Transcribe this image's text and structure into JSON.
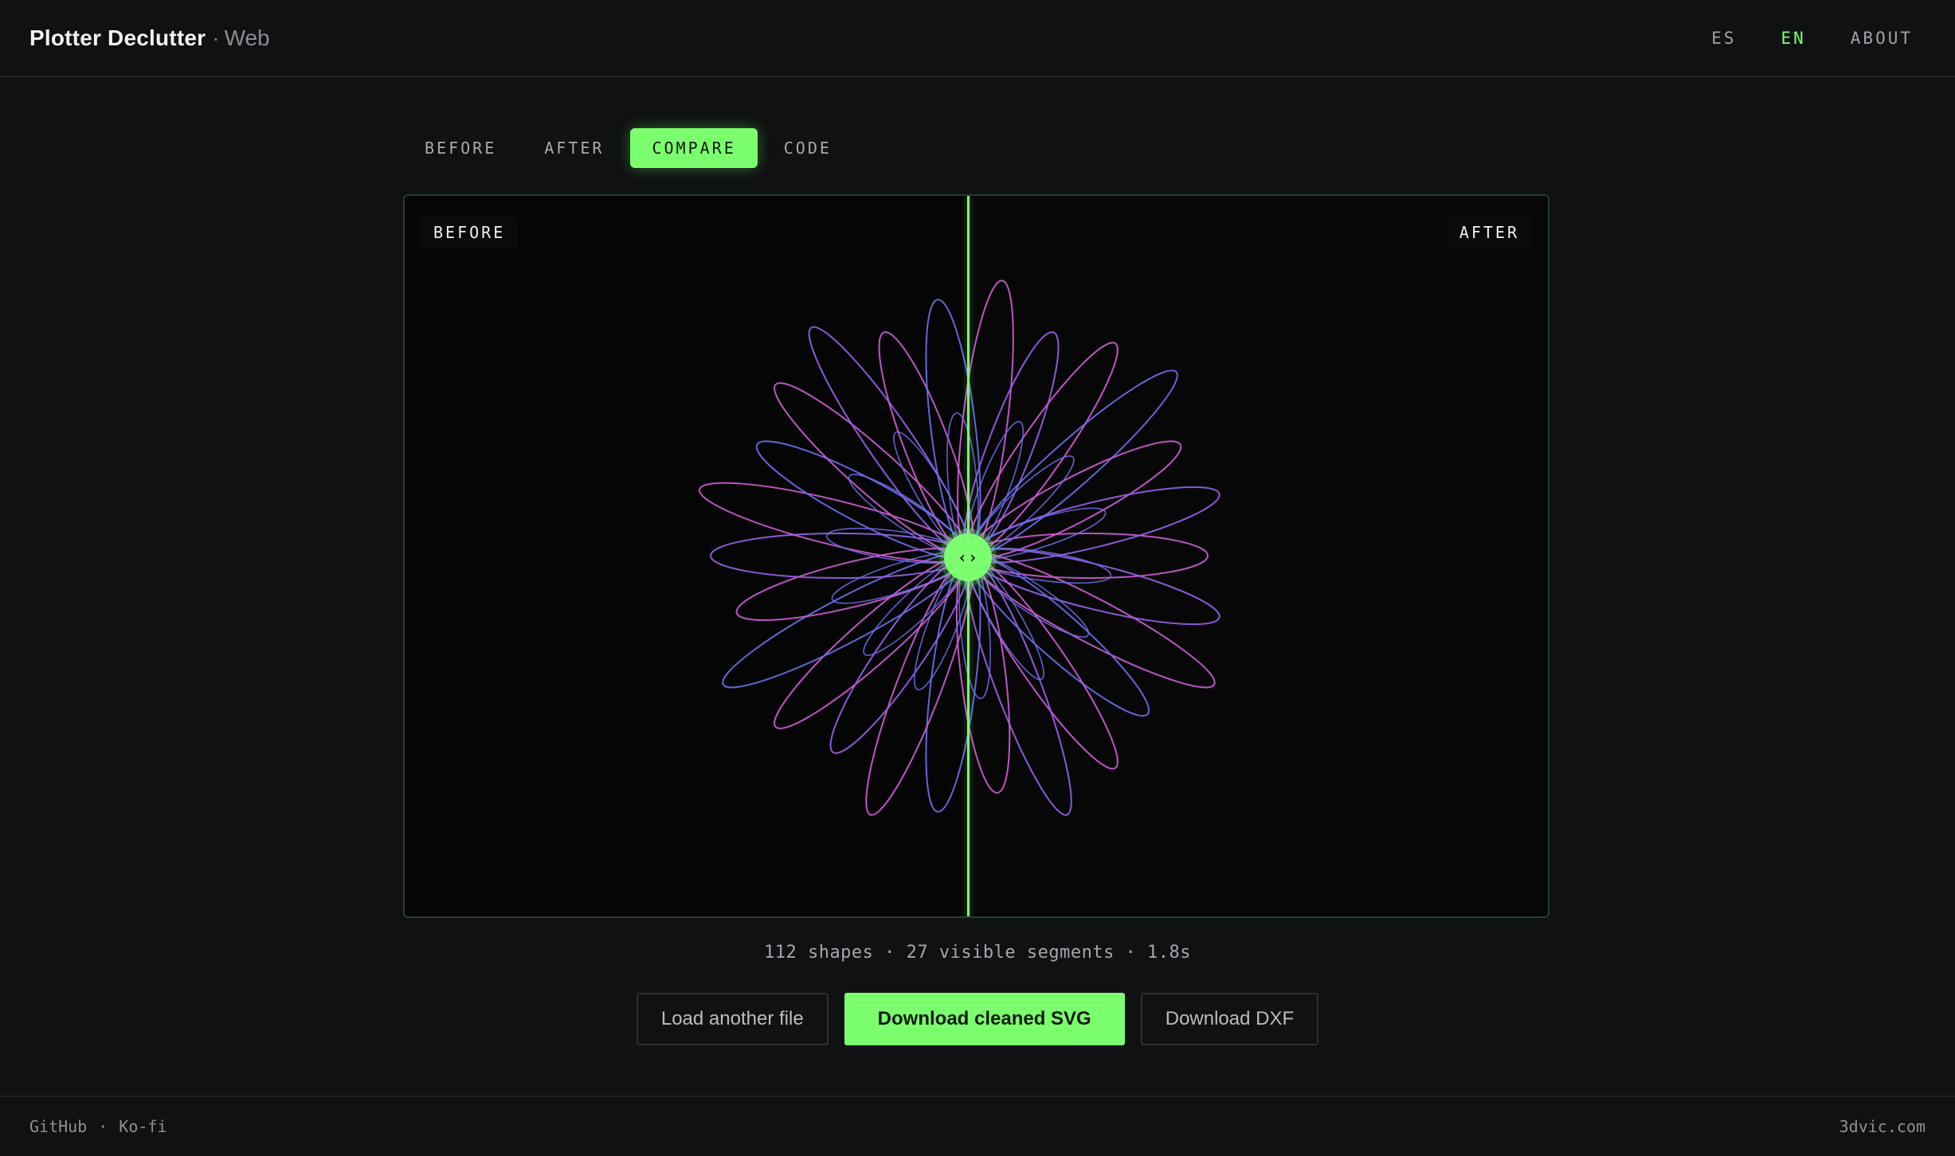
{
  "header": {
    "brand_name": "Plotter Declutter",
    "brand_separator": "·",
    "brand_suffix": "Web",
    "nav": [
      {
        "label": "ES",
        "active": false
      },
      {
        "label": "EN",
        "active": true
      },
      {
        "label": "ABOUT",
        "active": false
      }
    ]
  },
  "tabs": [
    {
      "label": "BEFORE",
      "active": false
    },
    {
      "label": "AFTER",
      "active": false
    },
    {
      "label": "COMPARE",
      "active": true
    },
    {
      "label": "CODE",
      "active": false
    }
  ],
  "compare": {
    "before_label": "BEFORE",
    "after_label": "AFTER",
    "handle_glyph": "‹›",
    "split_fraction": 0.49,
    "colors": {
      "accent": "#7cff6e",
      "stroke_pink": "#d05fd8",
      "stroke_violet": "#9a63f0",
      "stroke_blue": "#6e70ee"
    }
  },
  "stats": {
    "text": "112 shapes · 27 visible segments · 1.8s"
  },
  "actions": {
    "load_label": "Load another file",
    "download_svg_label": "Download cleaned SVG",
    "download_dxf_label": "Download DXF"
  },
  "footer": {
    "github": "GitHub",
    "separator": "·",
    "kofi": "Ko-fi",
    "site": "3dvic.com"
  }
}
